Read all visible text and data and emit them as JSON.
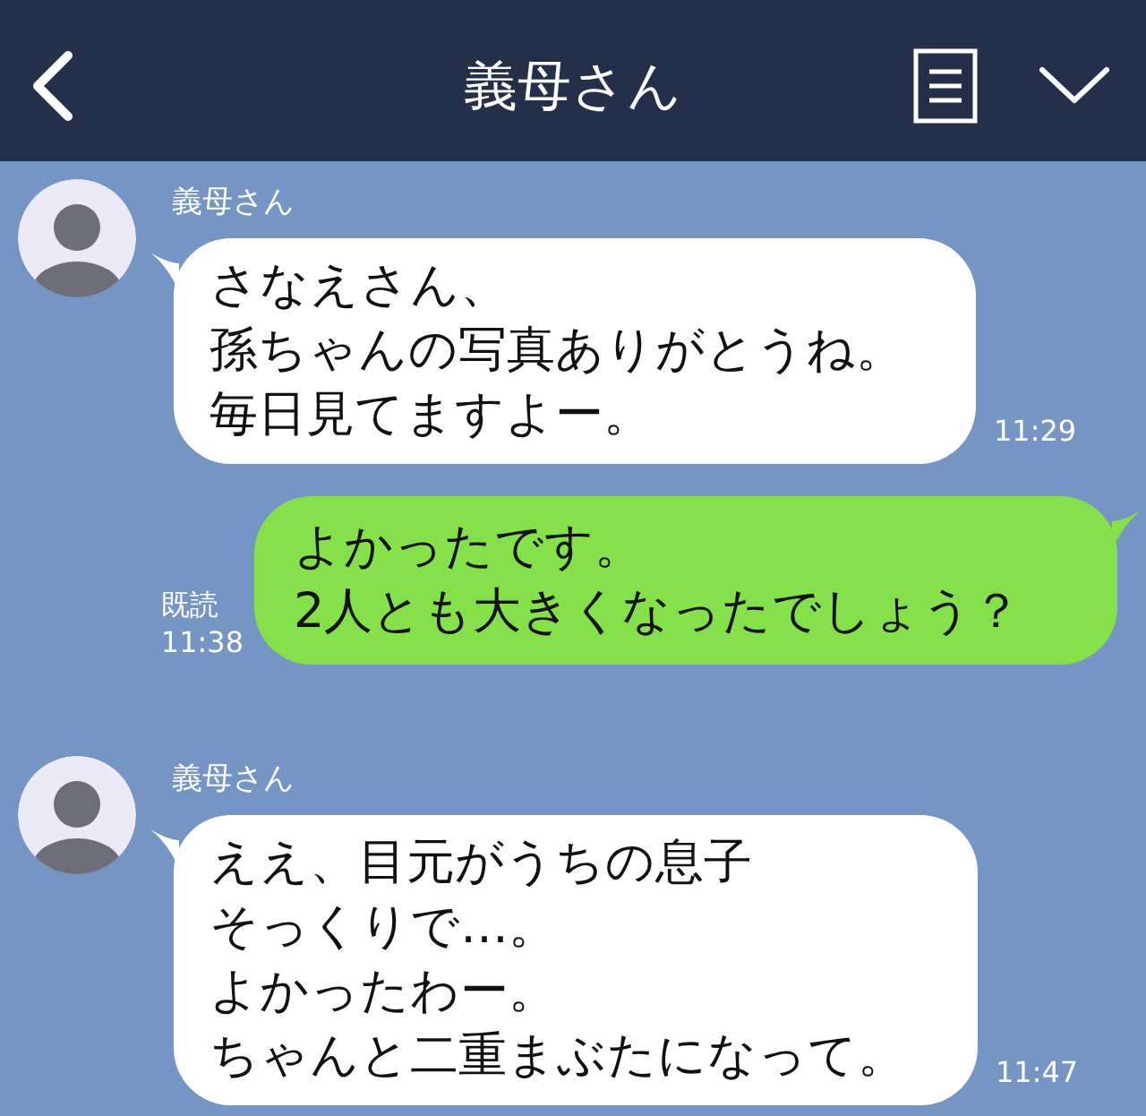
{
  "header": {
    "title": "義母さん"
  },
  "messages": [
    {
      "kind": "received",
      "sender": "義母さん",
      "lines": [
        "さなえさん、",
        "孫ちゃんの写真ありがとうね。",
        "毎日見てますよー。"
      ],
      "time": "11:29"
    },
    {
      "kind": "sent",
      "read": "既読",
      "lines": [
        "よかったです。",
        "2人とも大きくなったでしょう？"
      ],
      "time": "11:38"
    },
    {
      "kind": "received",
      "sender": "義母さん",
      "lines": [
        "ええ、目元がうちの息子",
        "そっくりで…。",
        "よかったわー。",
        "ちゃんと二重まぶたになって。"
      ],
      "time": "11:47"
    }
  ]
}
